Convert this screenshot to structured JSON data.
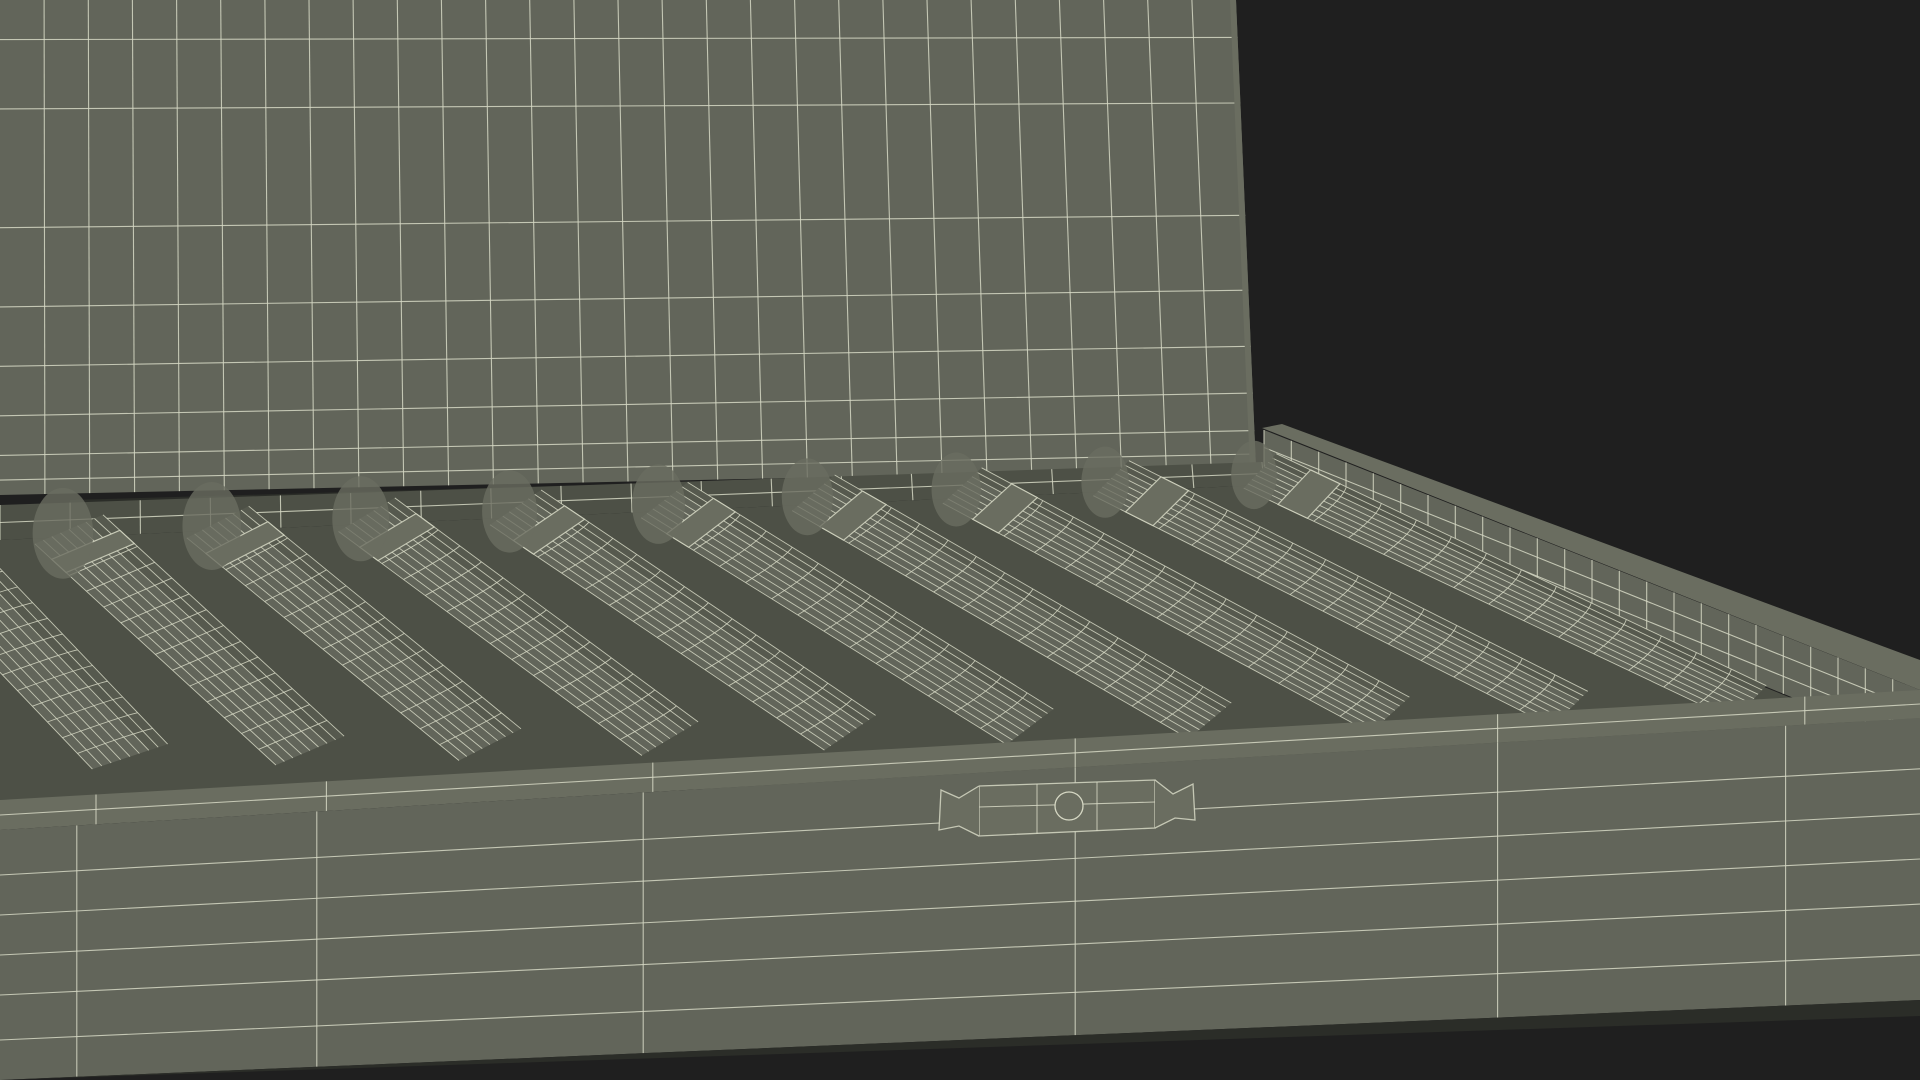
{
  "scene": {
    "subject": "",
    "render_style": "wireframe",
    "cigar_count": 10
  },
  "colors": {
    "background": "#1f1f1f",
    "surface": "#62655a",
    "surface_light": "#6a6d60",
    "surface_dark": "#4d5046",
    "shadow": "#2b2d28",
    "wire": "#d6d8c4"
  }
}
